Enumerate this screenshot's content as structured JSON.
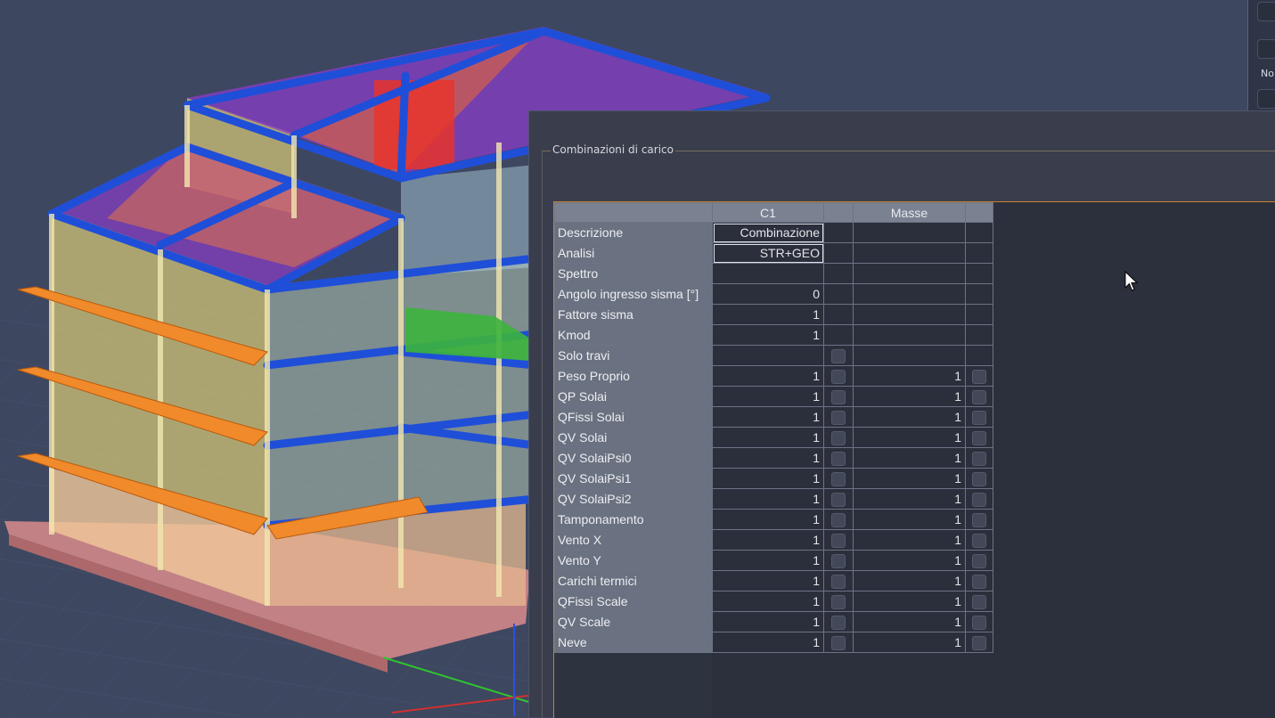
{
  "panel": {
    "group_title": "Combinazioni di carico"
  },
  "toolbar": {
    "label": "No"
  },
  "table": {
    "columns": [
      "",
      "C1",
      "",
      "Masse",
      ""
    ],
    "rows": [
      {
        "label": "Descrizione",
        "c1": "Combinazione",
        "c1_check": false,
        "masse": "",
        "masse_check": false
      },
      {
        "label": "Analisi",
        "c1": "STR+GEO",
        "c1_check": false,
        "masse": "",
        "masse_check": false
      },
      {
        "label": "Spettro",
        "c1": "",
        "c1_check": false,
        "masse": "",
        "masse_check": false
      },
      {
        "label": "Angolo ingresso sisma [°]",
        "c1": "0",
        "c1_check": false,
        "masse": "",
        "masse_check": false
      },
      {
        "label": "Fattore sisma",
        "c1": "1",
        "c1_check": false,
        "masse": "",
        "masse_check": false
      },
      {
        "label": "Kmod",
        "c1": "1",
        "c1_check": false,
        "masse": "",
        "masse_check": false
      },
      {
        "label": "Solo travi",
        "c1": "",
        "c1_check": true,
        "masse": "",
        "masse_check": false
      },
      {
        "label": "Peso Proprio",
        "c1": "1",
        "c1_check": true,
        "masse": "1",
        "masse_check": true
      },
      {
        "label": "QP Solai",
        "c1": "1",
        "c1_check": true,
        "masse": "1",
        "masse_check": true
      },
      {
        "label": "QFissi Solai",
        "c1": "1",
        "c1_check": true,
        "masse": "1",
        "masse_check": true
      },
      {
        "label": "QV Solai",
        "c1": "1",
        "c1_check": true,
        "masse": "1",
        "masse_check": true
      },
      {
        "label": "QV SolaiPsi0",
        "c1": "1",
        "c1_check": true,
        "masse": "1",
        "masse_check": true
      },
      {
        "label": "QV SolaiPsi1",
        "c1": "1",
        "c1_check": true,
        "masse": "1",
        "masse_check": true
      },
      {
        "label": "QV SolaiPsi2",
        "c1": "1",
        "c1_check": true,
        "masse": "1",
        "masse_check": true
      },
      {
        "label": "Tamponamento",
        "c1": "1",
        "c1_check": true,
        "masse": "1",
        "masse_check": true
      },
      {
        "label": "Vento X",
        "c1": "1",
        "c1_check": true,
        "masse": "1",
        "masse_check": true
      },
      {
        "label": "Vento Y",
        "c1": "1",
        "c1_check": true,
        "masse": "1",
        "masse_check": true
      },
      {
        "label": "Carichi termici",
        "c1": "1",
        "c1_check": true,
        "masse": "1",
        "masse_check": true
      },
      {
        "label": "QFissi Scale",
        "c1": "1",
        "c1_check": true,
        "masse": "1",
        "masse_check": true
      },
      {
        "label": "QV Scale",
        "c1": "1",
        "c1_check": true,
        "masse": "1",
        "masse_check": true
      },
      {
        "label": "Neve",
        "c1": "1",
        "c1_check": true,
        "masse": "1",
        "masse_check": true
      }
    ]
  },
  "colors": {
    "viewport_bg": "#3d4760",
    "panel_bg": "#3a3e4c",
    "accent_border": "#c8822d",
    "beam_blue": "#1f4fd8",
    "roof_purple": "#7a2fc0",
    "balcony_orange": "#f08a2a",
    "wall_yellow": "#e8d77a",
    "slab_green": "#3cb43c"
  }
}
